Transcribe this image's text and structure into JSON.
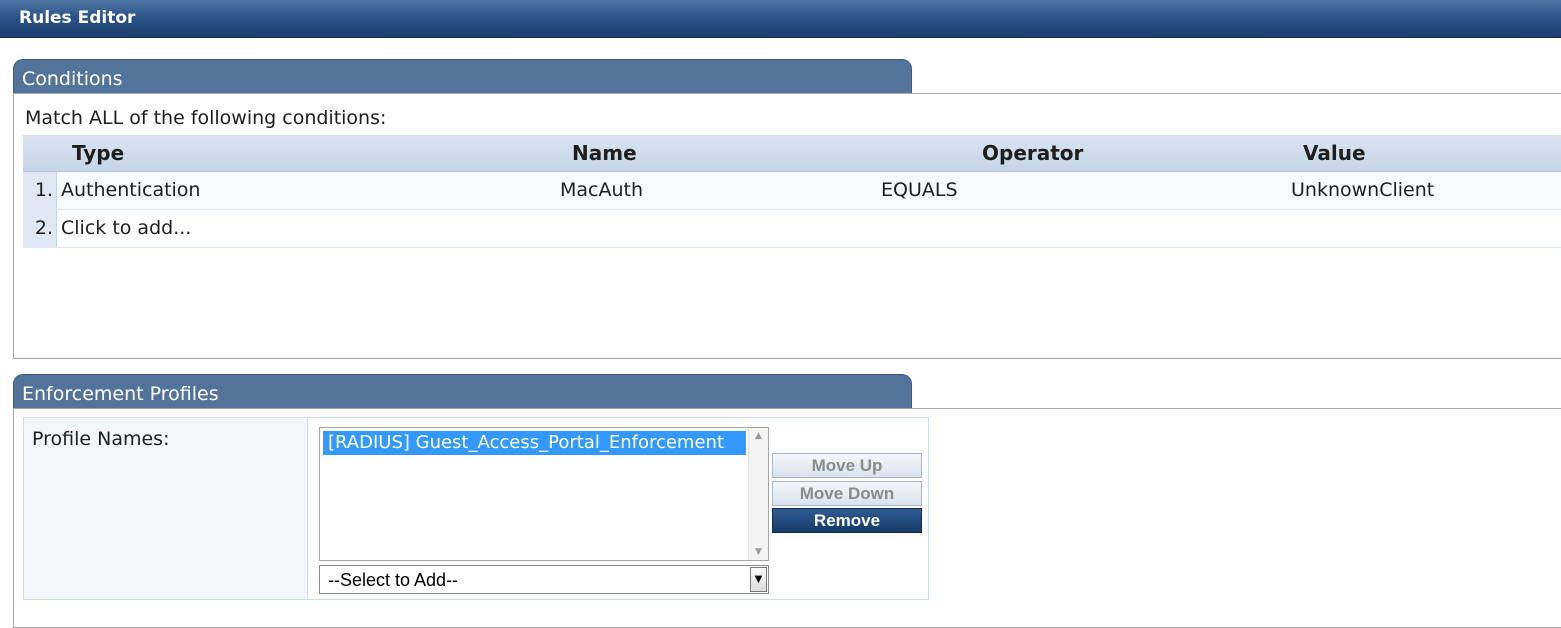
{
  "window": {
    "title": "Rules Editor"
  },
  "conditions": {
    "section_title": "Conditions",
    "match_text": "Match ALL of the following conditions:",
    "columns": {
      "type": "Type",
      "name": "Name",
      "operator": "Operator",
      "value": "Value"
    },
    "rows": [
      {
        "num": "1.",
        "type": "Authentication",
        "name": "MacAuth",
        "operator": "EQUALS",
        "value": "UnknownClient"
      }
    ],
    "add_row": {
      "num": "2.",
      "label": "Click to add..."
    }
  },
  "enforcement": {
    "section_title": "Enforcement Profiles",
    "profile_label": "Profile Names:",
    "profiles": [
      "[RADIUS] Guest_Access_Portal_Enforcement"
    ],
    "select_placeholder": "--Select to Add--",
    "buttons": {
      "move_up": "Move Up",
      "move_down": "Move Down",
      "remove": "Remove"
    }
  },
  "colors": {
    "title_bar": "#2c5487",
    "section_tab": "#52739a",
    "selection": "#3399ff",
    "primary_button": "#1f4576"
  }
}
